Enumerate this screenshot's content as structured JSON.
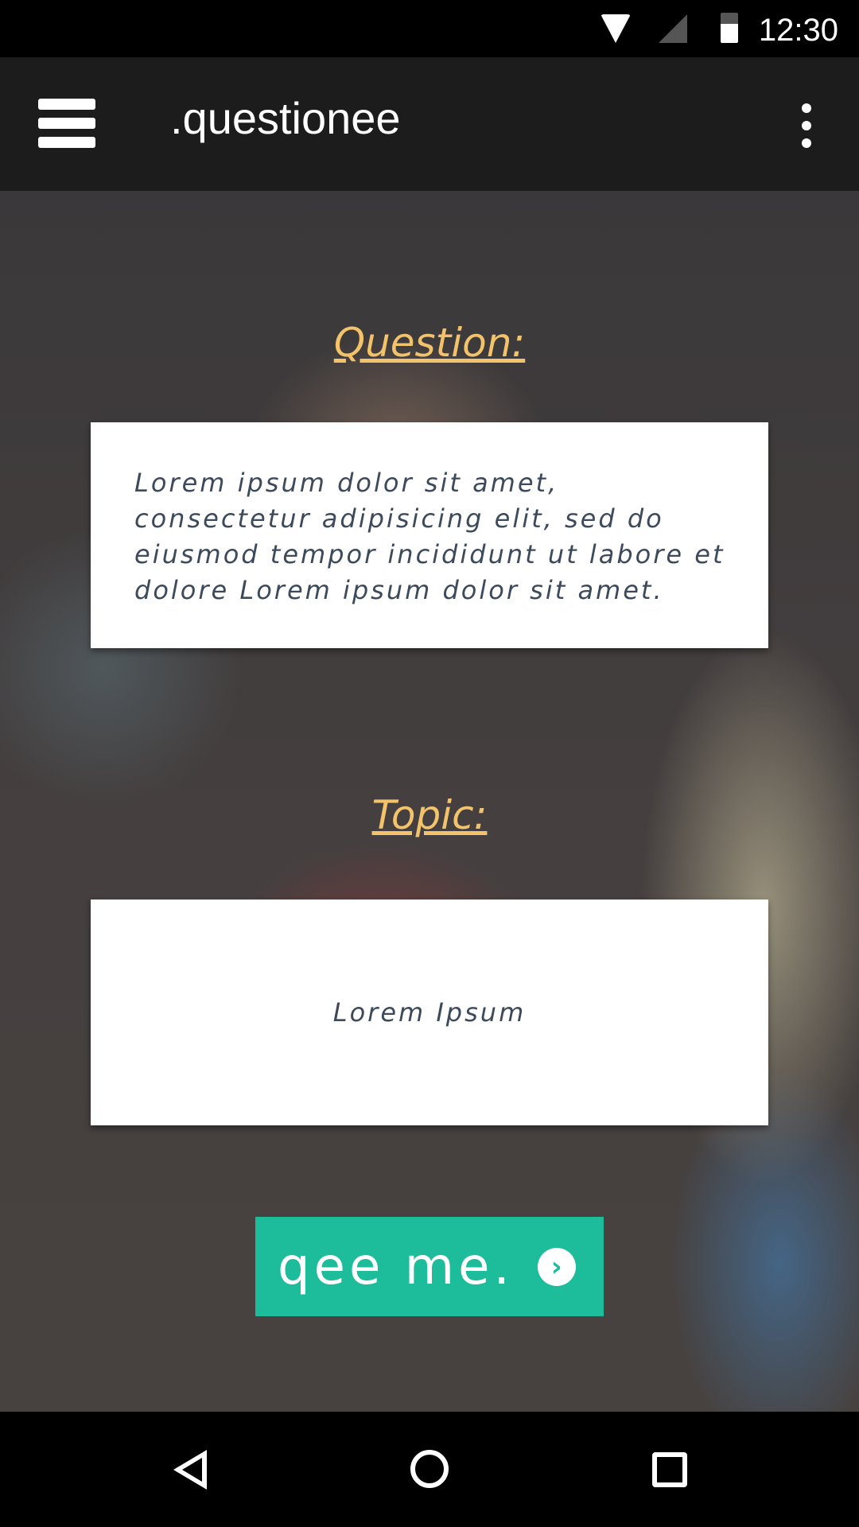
{
  "status_bar": {
    "time": "12:30",
    "icons": [
      "wifi-icon",
      "cell-signal-icon",
      "battery-icon"
    ]
  },
  "app_bar": {
    "title": ".questionee",
    "menu_icon": "hamburger-menu-icon",
    "overflow_icon": "more-vertical-icon"
  },
  "main": {
    "question_label": "Question:",
    "question_text": "Lorem ipsum dolor sit amet, consectetur adipisicing elit, sed do eiusmod tempor incididunt ut labore et dolore Lorem ipsum dolor sit amet.",
    "topic_label": "Topic:",
    "topic_text": "Lorem Ipsum",
    "submit_label": "qee me.",
    "submit_icon": "chevron-right-circle-icon"
  },
  "colors": {
    "accent": "#1dbc9b",
    "label": "#f2c36b",
    "appbar": "#1c1c1c"
  },
  "nav_bar": {
    "icons": [
      "back-icon",
      "home-icon",
      "recents-icon"
    ]
  }
}
